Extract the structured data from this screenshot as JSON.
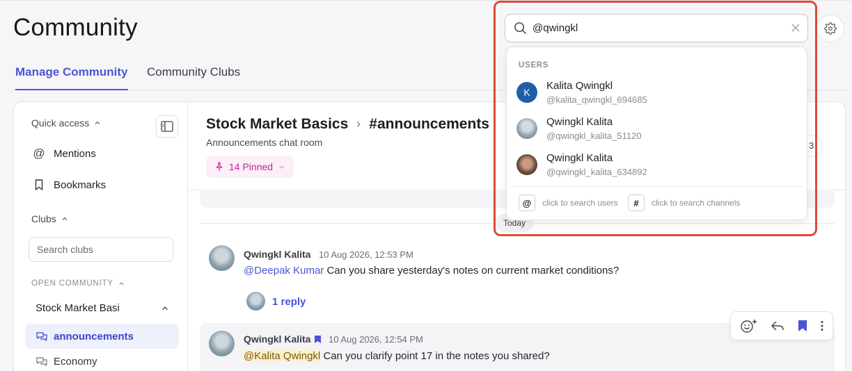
{
  "page": {
    "title": "Community"
  },
  "tabs": [
    {
      "label": "Manage Community",
      "active": true
    },
    {
      "label": "Community Clubs",
      "active": false
    }
  ],
  "sidebar": {
    "quick_access": "Quick access",
    "mentions": "Mentions",
    "bookmarks": "Bookmarks",
    "clubs": "Clubs",
    "search_placeholder": "Search clubs",
    "open_community": "OPEN COMMUNITY",
    "club_name": "Stock Market Basi",
    "channels": [
      "announcements",
      "Economy"
    ]
  },
  "channel": {
    "club": "Stock Market Basics",
    "name": "#announcements",
    "subtitle": "Announcements chat room",
    "pinned": "14 Pinned",
    "members_partial": "3",
    "today": "Today"
  },
  "messages": [
    {
      "author": "Qwingkl Kalita",
      "time": "10 Aug 2026, 12:53 PM",
      "mention": "@Deepak Kumar",
      "text": "Can you share yesterday's notes on current market conditions?",
      "reply": "1 reply"
    },
    {
      "author": "Qwingkl Kalita",
      "time": "10 Aug 2026, 12:54 PM",
      "mention": "@Kalita Qwingkl",
      "text": "Can you clarify point 17 in the notes you shared?"
    }
  ],
  "search": {
    "value": "@qwingkl",
    "section": "USERS",
    "users": [
      {
        "initial": "K",
        "name": "Kalita Qwingkl",
        "handle": "@kalita_qwingkl_694685"
      },
      {
        "name": "Qwingkl Kalita",
        "handle": "@qwingkl_kalita_51120"
      },
      {
        "name": "Qwingkl Kalita",
        "handle": "@qwingkl_kalita_634892"
      }
    ],
    "hint_users_key": "@",
    "hint_users": "click to search users",
    "hint_channels_key": "#",
    "hint_channels": "click to search channels"
  },
  "colors": {
    "accent": "#4a55d6",
    "highlight_border": "#dc4a3a",
    "pinned": "#c2268f"
  }
}
